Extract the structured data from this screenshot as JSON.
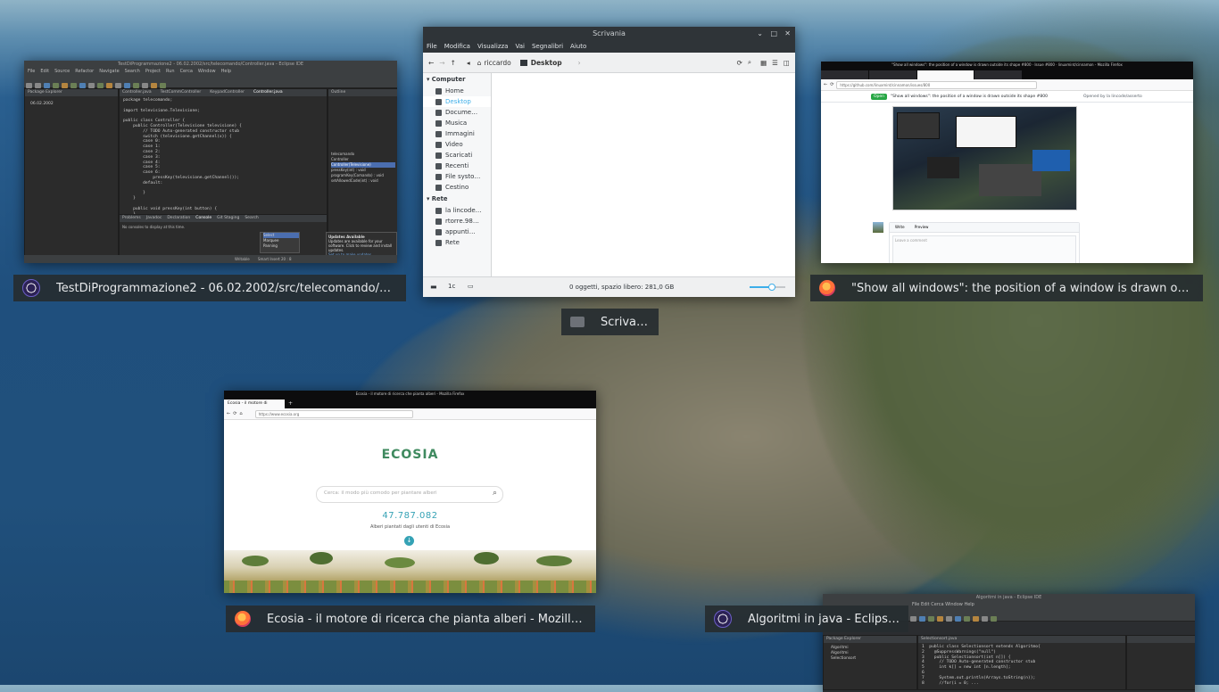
{
  "windows": {
    "eclipse1": {
      "title_bar": "TestDiProgrammazione2 - 06.02.2002/src/telecomando/Controller.java - Eclipse IDE",
      "caption": "TestDiProgrammazione2 - 06.02.2002/src/telecomando/Contr…",
      "menu": [
        "File",
        "Edit",
        "Source",
        "Refactor",
        "Navigate",
        "Search",
        "Project",
        "Run",
        "Cerca",
        "Window",
        "Help"
      ],
      "explorer_title": "Package Explorer",
      "explorer_item": "06.02.2002",
      "editor_tabs": [
        "Controller.java",
        "TestCommController",
        "KeypadController",
        "Controller.java"
      ],
      "code_lines": [
        "package telecomando;",
        "",
        "import televisione.Televisione;",
        "",
        "public class Controller {",
        "    public Controller(Televisione televisione) {",
        "        // TODO Auto-generated constructor stub",
        "        switch (televisione.getChannel(x)) {",
        "        case 0:",
        "        case 1:",
        "        case 2:",
        "        case 3:",
        "        case 4:",
        "        case 5:",
        "        case 6:",
        "            pressKey(televisione.getChannel());",
        "        default:",
        "",
        "        }",
        "    }",
        "",
        "    public void pressKey(int button) {",
        "    }"
      ],
      "outline_title": "Outline",
      "outline_items": [
        "telecomando",
        "Controller",
        "Controller(Televisione)",
        "pressKey(int) : void",
        "programKey(Comando) : void",
        "setAllowedCode(int) : void"
      ],
      "bottom_tabs": [
        "Problems",
        "Javadoc",
        "Declaration",
        "Console",
        "Git Staging",
        "Search"
      ],
      "console_text": "No consoles to display at this time.",
      "status_left": "Writable",
      "status_mid": "Smart Insert",
      "status_pos": "20 : 8",
      "update_title": "Updates Available",
      "update_text": "Updates are available for your software. Click to review and install updates.",
      "update_link": "Set up to make updates",
      "popup_items": [
        "Select",
        "Marquee",
        "Panning"
      ]
    },
    "dolphin": {
      "title": "Scrivania",
      "caption": "Scrivania",
      "menu": [
        "File",
        "Modifica",
        "Visualizza",
        "Vai",
        "Segnalibri",
        "Aiuto"
      ],
      "path": [
        "riccardo",
        "Desktop"
      ],
      "sections": [
        {
          "name": "Computer",
          "items": [
            "Home",
            "Desktop",
            "Docume…",
            "Musica",
            "Immagini",
            "Video",
            "Scaricati",
            "Recenti",
            "File systo…",
            "Cestino"
          ]
        },
        {
          "name": "Rete",
          "items": [
            "la lincode…",
            "rtorre.98…",
            "appunti…",
            "Rete"
          ]
        }
      ],
      "selected_item": "Desktop",
      "status": "0 oggetti, spazio libero: 281,0 GB",
      "zoom_fraction": 0.6
    },
    "firefox_github": {
      "caption": "\"Show all windows\": the position of a window is drawn outside it…",
      "title_bar": "\"Show all windows\": the position of a window is drawn outside its shape #800 · Issue #800 · linuxmint/cinnamon - Mozilla Firefox",
      "url": "https://github.com/linuxmint/cinnamon/issues/800",
      "badge": "Open",
      "issue_title": "\"Show all windows\": the position of a window is drawn outside its shape #800",
      "opened_by": "Opened by la lincode/asserto",
      "write_tab": "Write",
      "preview_tab": "Preview",
      "comment_placeholder": "Leave a comment"
    },
    "ecosia": {
      "caption": "Ecosia - il motore di ricerca che pianta alberi - Mozilla Firefox",
      "title_bar": "Ecosia - il motore di ricerca che pianta alberi - Mozilla Firefox",
      "tab": "Ecosia - il motore di ricerca",
      "url": "https://www.ecosia.org",
      "logo": "ECOSIA",
      "search_placeholder": "Cerca: il modo più comodo per piantare alberi",
      "counter": "47.787.082",
      "counter_label": "Alberi piantati dagli utenti di Ecosia"
    },
    "eclipse2": {
      "caption": "Algoritmi in java - Eclipse IDE",
      "title_bar": "Algoritmi in java - Eclipse IDE",
      "explorer_title": "Package Explorer",
      "explorer_items": [
        "Algoritmi",
        "Algoritmi",
        "Selectionsort"
      ],
      "editor_tab": "Selectionsort.java",
      "code_lines": [
        "1  public class Selectionsort extends Algoritmo{",
        "2    @SuppressWarnings(\"null\")",
        "3    public Selectionsort(int n[]) {",
        "4      // TODO Auto-generated constructor stub",
        "5      int k[] = new int [n.length];",
        "6",
        "7      System.out.println(Arrays.toString(n));",
        "8      //for(i = 0; ..."
      ]
    }
  }
}
